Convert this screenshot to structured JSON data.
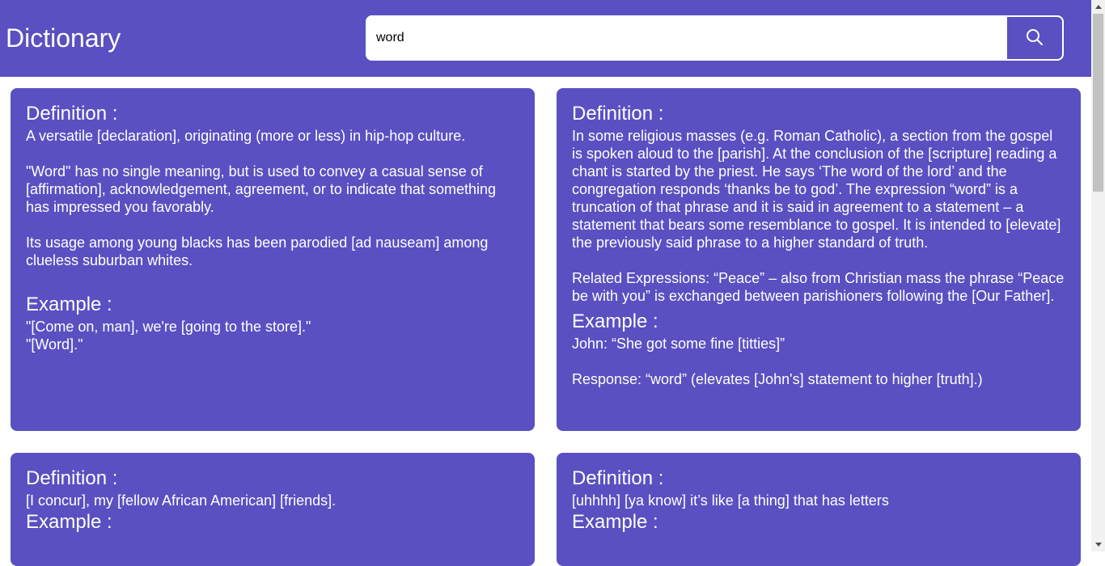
{
  "header": {
    "title": "Dictionary",
    "search_value": "word",
    "search_icon": "search-icon"
  },
  "cards": [
    {
      "definition_heading": "Definition :",
      "definition": "A versatile [declaration], originating (more or less) in hip-hop culture.\n\n\"Word\" has no single meaning, but is used to convey a casual sense of [affirmation], acknowledgement, agreement, or to indicate that something has impressed you favorably.\n\nIts usage among young blacks has been parodied [ad nauseam] among clueless suburban whites.",
      "example_heading": "Example :",
      "example": "\"[Come on, man], we're [going to the store].\"\n\"[Word].\""
    },
    {
      "definition_heading": "Definition :",
      "definition": "In some religious masses (e.g. Roman Catholic), a section from the gospel is spoken aloud to the [parish]. At the conclusion of the [scripture] reading a chant is started by the priest. He says ‘The word of the lord’ and the congregation responds ‘thanks be to god’. The expression “word” is a truncation of that phrase and it is said in agreement to a statement – a statement that bears some resemblance to gospel. It is intended to [elevate] the previously said phrase to a higher standard of truth.\n\nRelated Expressions: “Peace” – also from Christian mass the phrase “Peace be with you” is exchanged between parishioners following the [Our Father].",
      "example_heading": "Example :",
      "example": "John: “She got some fine [titties]”\n\nResponse: “word” (elevates [John's] statement to higher [truth].)"
    },
    {
      "definition_heading": "Definition :",
      "definition": "[I concur], my [fellow African American] [friends].",
      "example_heading": "Example :",
      "example": ""
    },
    {
      "definition_heading": "Definition :",
      "definition": "[uhhhh] [ya know] it’s like [a thing] that has letters",
      "example_heading": "Example :",
      "example": ""
    }
  ],
  "colors": {
    "accent": "#5a50c1",
    "text_on_accent": "#ffffff"
  }
}
